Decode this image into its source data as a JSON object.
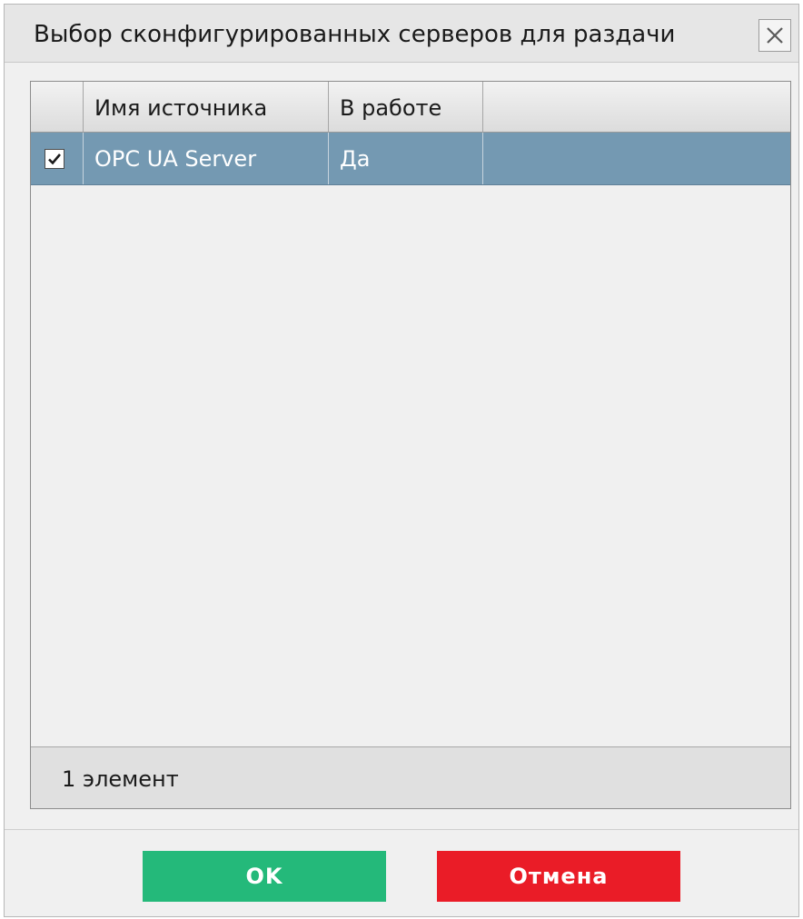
{
  "dialog": {
    "title": "Выбор сконфигурированных серверов для раздачи",
    "close_icon": "close-icon"
  },
  "grid": {
    "columns": [
      "",
      "Имя источника",
      "В работе",
      ""
    ],
    "rows": [
      {
        "checked": true,
        "source_name": "OPC UA Server",
        "in_work": "Да"
      }
    ],
    "footer_count": "1 элемент"
  },
  "buttons": {
    "ok_label": "OK",
    "cancel_label": "Отмена"
  },
  "colors": {
    "selected_row": "#7499b2",
    "ok": "#24b97a",
    "cancel": "#ea1c27"
  }
}
